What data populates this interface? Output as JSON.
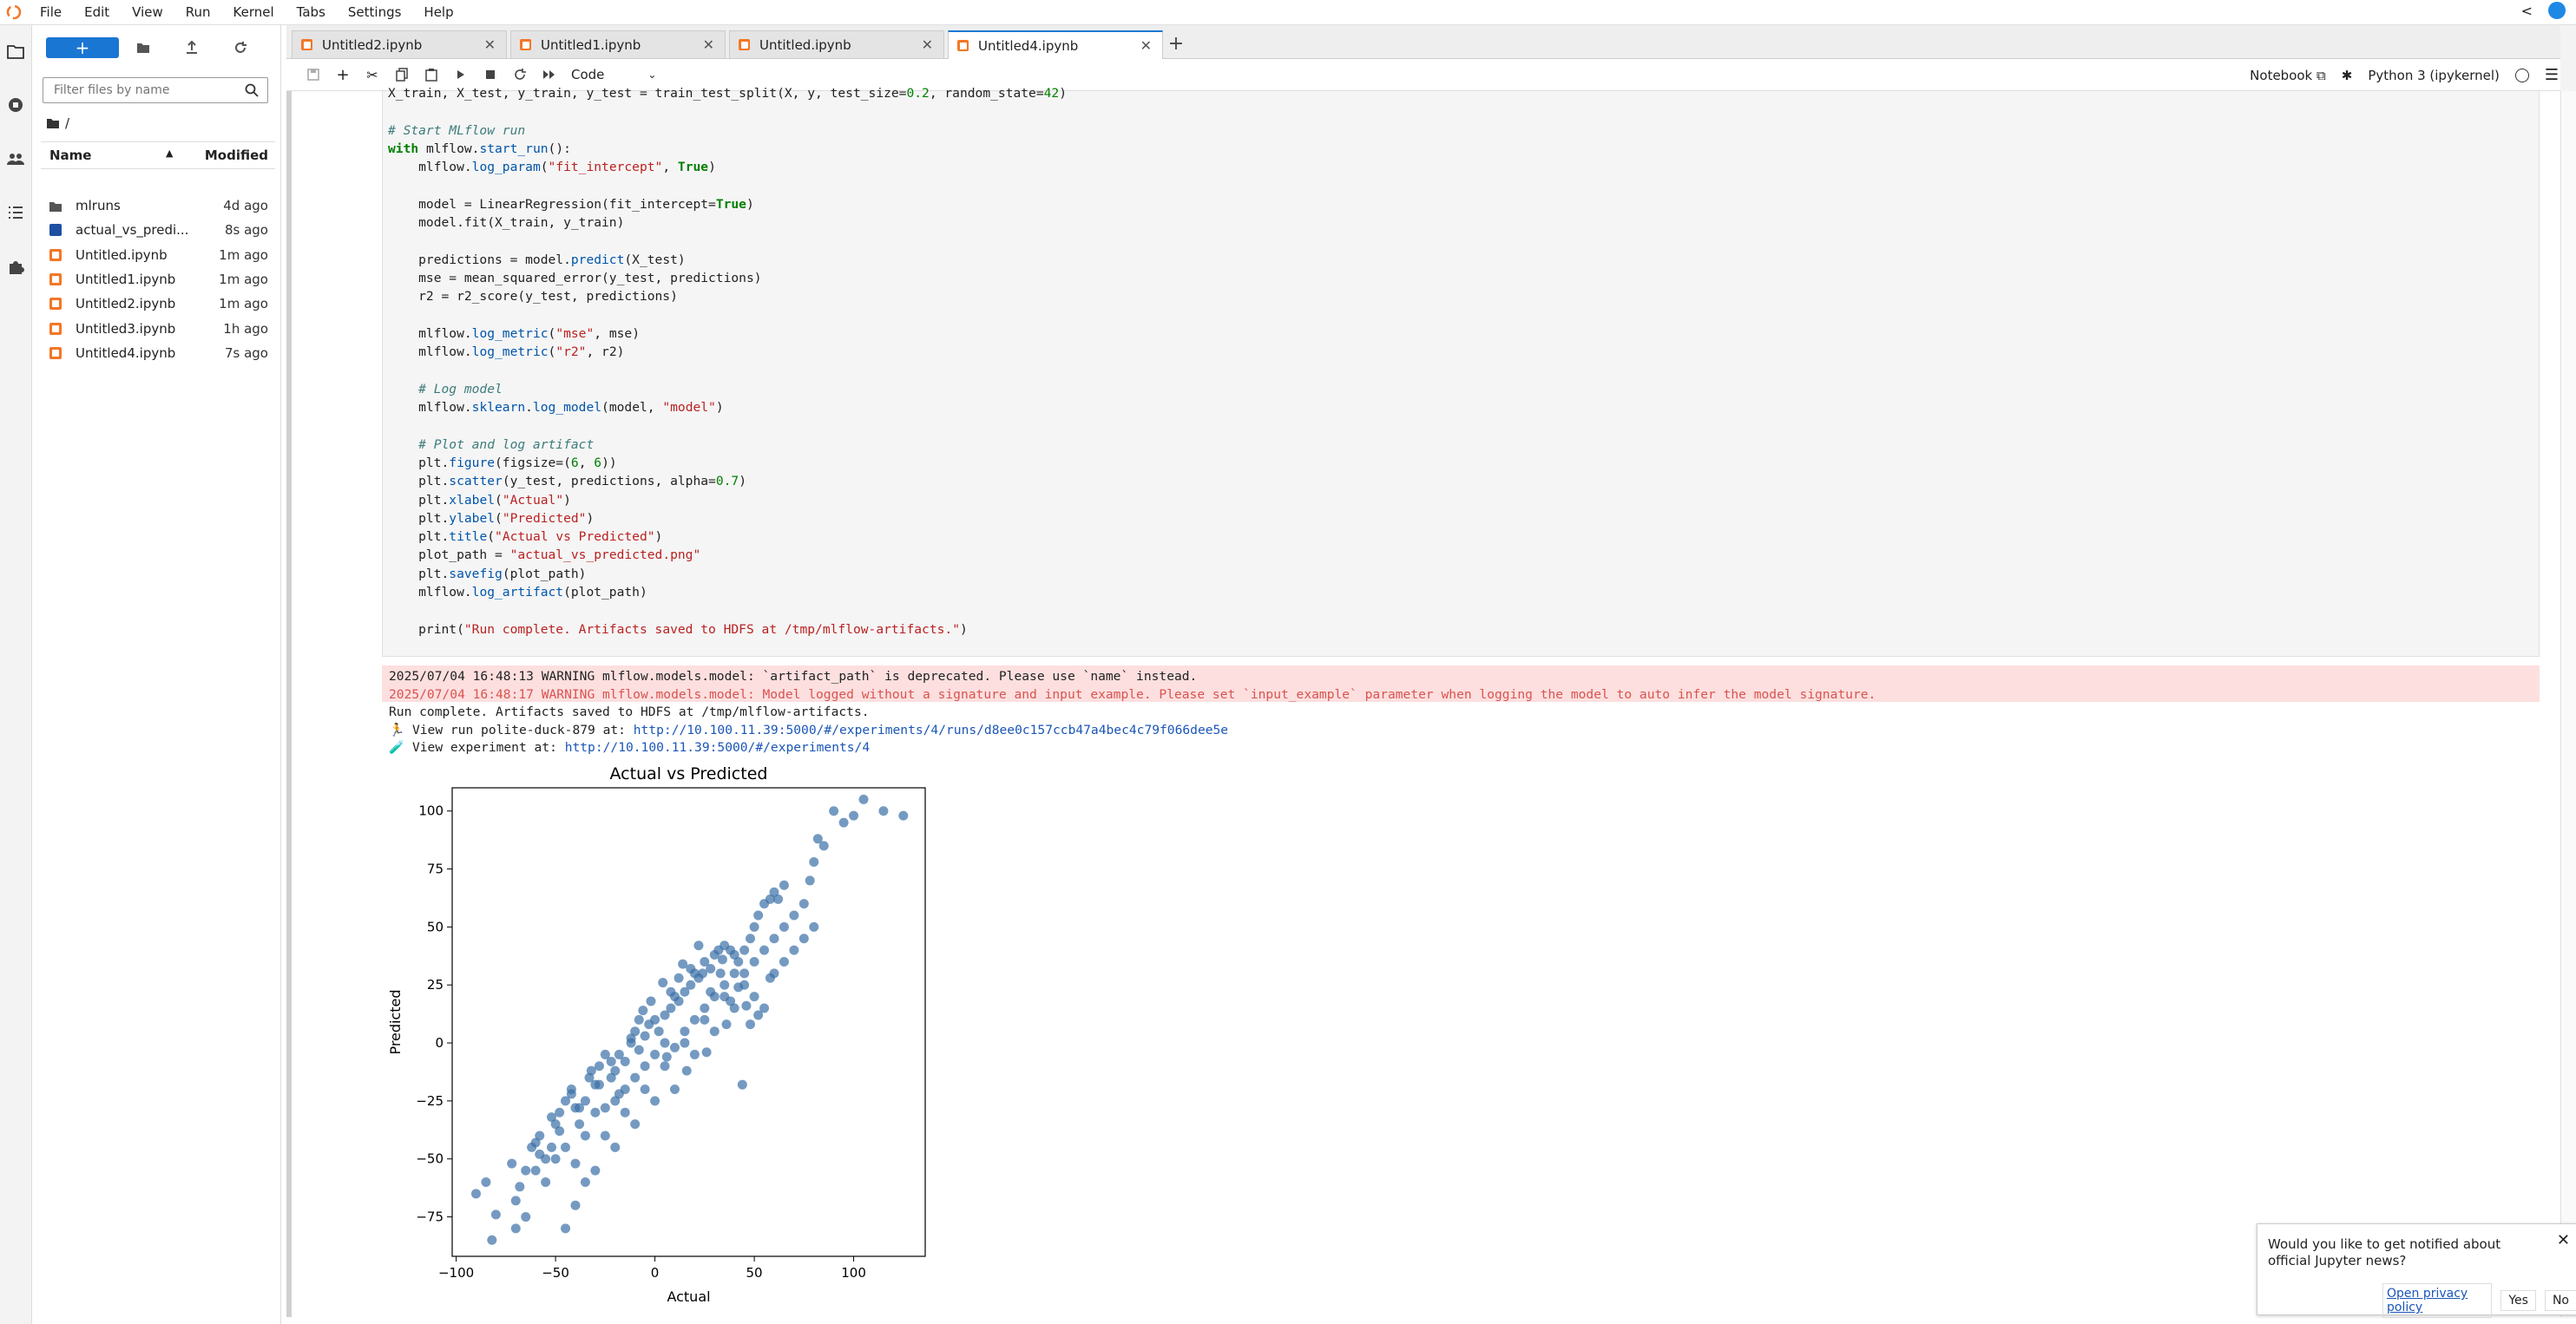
{
  "menubar": {
    "items": [
      "File",
      "Edit",
      "View",
      "Run",
      "Kernel",
      "Tabs",
      "Settings",
      "Help"
    ]
  },
  "filebrowser": {
    "new_label": "+",
    "filter_placeholder": "Filter files by name",
    "breadcrumb": "/",
    "col_name": "Name",
    "col_modified": "Modified",
    "files": [
      {
        "name": "mlruns",
        "modified": "4d ago",
        "type": "folder"
      },
      {
        "name": "actual_vs_predi...",
        "modified": "8s ago",
        "type": "image"
      },
      {
        "name": "Untitled.ipynb",
        "modified": "1m ago",
        "type": "notebook"
      },
      {
        "name": "Untitled1.ipynb",
        "modified": "1m ago",
        "type": "notebook"
      },
      {
        "name": "Untitled2.ipynb",
        "modified": "1m ago",
        "type": "notebook"
      },
      {
        "name": "Untitled3.ipynb",
        "modified": "1h ago",
        "type": "notebook"
      },
      {
        "name": "Untitled4.ipynb",
        "modified": "7s ago",
        "type": "notebook"
      }
    ]
  },
  "tabs": [
    {
      "label": "Untitled2.ipynb",
      "active": false
    },
    {
      "label": "Untitled1.ipynb",
      "active": false
    },
    {
      "label": "Untitled.ipynb",
      "active": false
    },
    {
      "label": "Untitled4.ipynb",
      "active": true
    }
  ],
  "toolbar": {
    "cell_type": "Code",
    "notebook_label": "Notebook",
    "kernel_label": "Python 3 (ipykernel)"
  },
  "code_lines": [
    "X_train, X_test, y_train, y_test = train_test_split(X, y, test_size=0.2, random_state=42)",
    "",
    "# Start MLflow run",
    "with mlflow.start_run():",
    "    mlflow.log_param(\"fit_intercept\", True)",
    "",
    "    model = LinearRegression(fit_intercept=True)",
    "    model.fit(X_train, y_train)",
    "",
    "    predictions = model.predict(X_test)",
    "    mse = mean_squared_error(y_test, predictions)",
    "    r2 = r2_score(y_test, predictions)",
    "",
    "    mlflow.log_metric(\"mse\", mse)",
    "    mlflow.log_metric(\"r2\", r2)",
    "",
    "    # Log model",
    "    mlflow.sklearn.log_model(model, \"model\")",
    "",
    "    # Plot and log artifact",
    "    plt.figure(figsize=(6, 6))",
    "    plt.scatter(y_test, predictions, alpha=0.7)",
    "    plt.xlabel(\"Actual\")",
    "    plt.ylabel(\"Predicted\")",
    "    plt.title(\"Actual vs Predicted\")",
    "    plot_path = \"actual_vs_predicted.png\"",
    "    plt.savefig(plot_path)",
    "    mlflow.log_artifact(plot_path)",
    "",
    "    print(\"Run complete. Artifacts saved to HDFS at /tmp/mlflow-artifacts.\")"
  ],
  "output": {
    "warning1": "2025/07/04 16:48:13 WARNING mlflow.models.model: `artifact_path` is deprecated. Please use `name` instead.",
    "warning2": "2025/07/04 16:48:17 WARNING mlflow.models.model: Model logged without a signature and input example. Please set `input_example` parameter when logging the model to auto infer the model signature.",
    "line3": "Run complete. Artifacts saved to HDFS at /tmp/mlflow-artifacts.",
    "line4_prefix": "🏃 View run polite-duck-879 at: ",
    "line4_link": "http://10.100.11.39:5000/#/experiments/4/runs/d8ee0c157ccb47a4bec4c79f066dee5e",
    "line5_prefix": "🧪 View experiment at: ",
    "line5_link": "http://10.100.11.39:5000/#/experiments/4"
  },
  "notification": {
    "message": "Would you like to get notified about official Jupyter news?",
    "privacy": "Open privacy policy",
    "yes": "Yes",
    "no": "No"
  },
  "chart_data": {
    "type": "scatter",
    "title": "Actual vs Predicted",
    "xlabel": "Actual",
    "ylabel": "Predicted",
    "xlim": [
      -102,
      136
    ],
    "ylim": [
      -92,
      110
    ],
    "xticks": [
      -100,
      -50,
      0,
      50,
      100
    ],
    "yticks": [
      -75,
      -50,
      -25,
      0,
      25,
      50,
      75,
      100
    ],
    "color": "#3b6fa6",
    "alpha": 0.7,
    "points": [
      [
        -90,
        -65
      ],
      [
        -82,
        -85
      ],
      [
        -80,
        -74
      ],
      [
        -70,
        -68
      ],
      [
        -68,
        -62
      ],
      [
        -65,
        -55
      ],
      [
        -62,
        -45
      ],
      [
        -60,
        -43
      ],
      [
        -58,
        -40
      ],
      [
        -55,
        -50
      ],
      [
        -52,
        -45
      ],
      [
        -50,
        -35
      ],
      [
        -48,
        -30
      ],
      [
        -45,
        -25
      ],
      [
        -42,
        -20
      ],
      [
        -40,
        -28
      ],
      [
        -38,
        -35
      ],
      [
        -35,
        -25
      ],
      [
        -33,
        -15
      ],
      [
        -30,
        -18
      ],
      [
        -28,
        -10
      ],
      [
        -25,
        -5
      ],
      [
        -22,
        -15
      ],
      [
        -20,
        -12
      ],
      [
        -18,
        -5
      ],
      [
        -15,
        -8
      ],
      [
        -12,
        0
      ],
      [
        -10,
        5
      ],
      [
        -8,
        -3
      ],
      [
        -5,
        3
      ],
      [
        -3,
        8
      ],
      [
        0,
        10
      ],
      [
        2,
        5
      ],
      [
        5,
        12
      ],
      [
        8,
        15
      ],
      [
        10,
        20
      ],
      [
        12,
        18
      ],
      [
        15,
        22
      ],
      [
        18,
        25
      ],
      [
        20,
        30
      ],
      [
        22,
        28
      ],
      [
        25,
        35
      ],
      [
        28,
        32
      ],
      [
        30,
        38
      ],
      [
        32,
        40
      ],
      [
        35,
        42
      ],
      [
        38,
        40
      ],
      [
        40,
        38
      ],
      [
        42,
        35
      ],
      [
        45,
        40
      ],
      [
        48,
        45
      ],
      [
        50,
        50
      ],
      [
        52,
        55
      ],
      [
        55,
        60
      ],
      [
        58,
        62
      ],
      [
        60,
        65
      ],
      [
        62,
        62
      ],
      [
        65,
        68
      ],
      [
        70,
        55
      ],
      [
        75,
        60
      ],
      [
        78,
        70
      ],
      [
        80,
        78
      ],
      [
        82,
        88
      ],
      [
        85,
        85
      ],
      [
        90,
        100
      ],
      [
        95,
        95
      ],
      [
        100,
        98
      ],
      [
        105,
        105
      ],
      [
        115,
        100
      ],
      [
        125,
        98
      ],
      [
        -60,
        -55
      ],
      [
        -55,
        -60
      ],
      [
        -50,
        -50
      ],
      [
        -45,
        -45
      ],
      [
        -40,
        -52
      ],
      [
        -35,
        -40
      ],
      [
        -30,
        -30
      ],
      [
        -25,
        -28
      ],
      [
        -20,
        -25
      ],
      [
        -15,
        -20
      ],
      [
        -10,
        -15
      ],
      [
        -5,
        -10
      ],
      [
        0,
        -5
      ],
      [
        5,
        0
      ],
      [
        10,
        -2
      ],
      [
        15,
        5
      ],
      [
        20,
        10
      ],
      [
        25,
        15
      ],
      [
        30,
        20
      ],
      [
        35,
        25
      ],
      [
        40,
        30
      ],
      [
        45,
        25
      ],
      [
        50,
        20
      ],
      [
        55,
        15
      ],
      [
        60,
        30
      ],
      [
        65,
        35
      ],
      [
        70,
        40
      ],
      [
        75,
        45
      ],
      [
        80,
        50
      ],
      [
        -70,
        -80
      ],
      [
        -65,
        -75
      ],
      [
        -45,
        -80
      ],
      [
        -40,
        -70
      ],
      [
        -35,
        -60
      ],
      [
        -30,
        -55
      ],
      [
        -20,
        -45
      ],
      [
        -10,
        -35
      ],
      [
        0,
        -25
      ],
      [
        10,
        -20
      ],
      [
        20,
        -5
      ],
      [
        30,
        5
      ],
      [
        40,
        15
      ],
      [
        50,
        35
      ],
      [
        60,
        45
      ],
      [
        -25,
        -40
      ],
      [
        -15,
        -30
      ],
      [
        -5,
        -20
      ],
      [
        5,
        -10
      ],
      [
        15,
        0
      ],
      [
        25,
        10
      ],
      [
        35,
        20
      ],
      [
        45,
        30
      ],
      [
        55,
        40
      ],
      [
        65,
        50
      ],
      [
        44,
        -18
      ],
      [
        -8,
        10
      ],
      [
        12,
        28
      ],
      [
        28,
        22
      ],
      [
        38,
        18
      ],
      [
        48,
        8
      ],
      [
        -2,
        18
      ],
      [
        8,
        22
      ],
      [
        18,
        32
      ],
      [
        -18,
        -22
      ],
      [
        -28,
        -18
      ],
      [
        -38,
        -28
      ],
      [
        -48,
        -38
      ],
      [
        -58,
        -48
      ],
      [
        -72,
        -52
      ],
      [
        -85,
        -60
      ],
      [
        22,
        42
      ],
      [
        33,
        30
      ],
      [
        42,
        24
      ],
      [
        52,
        12
      ],
      [
        58,
        28
      ],
      [
        -6,
        14
      ],
      [
        4,
        26
      ],
      [
        14,
        34
      ],
      [
        24,
        30
      ],
      [
        34,
        36
      ],
      [
        -12,
        2
      ],
      [
        -22,
        -8
      ],
      [
        -32,
        -12
      ],
      [
        -42,
        -22
      ],
      [
        -52,
        -32
      ],
      [
        6,
        -6
      ],
      [
        16,
        -12
      ],
      [
        26,
        -4
      ],
      [
        36,
        8
      ],
      [
        46,
        16
      ]
    ]
  }
}
